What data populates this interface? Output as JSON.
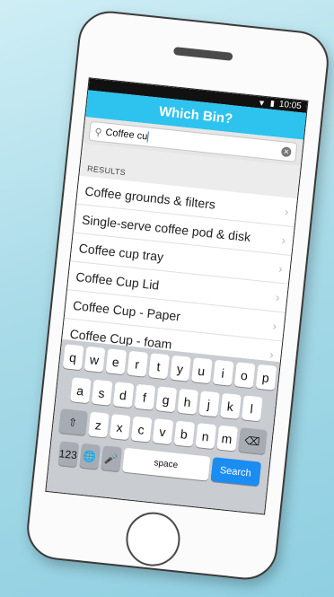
{
  "status": {
    "time": "10:05"
  },
  "app": {
    "title": "Which Bin?"
  },
  "search": {
    "value": "Coffee cu"
  },
  "results": {
    "header": "RESULTS",
    "items": [
      {
        "label": "Coffee grounds & filters"
      },
      {
        "label": "Single-serve coffee pod & disk"
      },
      {
        "label": "Coffee cup tray"
      },
      {
        "label": "Coffee Cup Lid"
      },
      {
        "label": "Coffee Cup - Paper"
      },
      {
        "label": "Coffee Cup - foam"
      }
    ]
  },
  "keyboard": {
    "row1": [
      "q",
      "w",
      "e",
      "r",
      "t",
      "y",
      "u",
      "i",
      "o",
      "p"
    ],
    "row2": [
      "a",
      "s",
      "d",
      "f",
      "g",
      "h",
      "j",
      "k",
      "l"
    ],
    "row3": [
      "z",
      "x",
      "c",
      "v",
      "b",
      "n",
      "m"
    ],
    "numbers_label": "123",
    "space_label": "space",
    "search_label": "Search"
  },
  "colors": {
    "accent": "#2ec3ee",
    "search_key": "#1a8cf2"
  },
  "icons": [
    "wifi-icon",
    "battery-icon",
    "search-icon",
    "clear-icon",
    "chevron-right-icon",
    "shift-icon",
    "globe-icon",
    "microphone-icon",
    "backspace-icon"
  ]
}
